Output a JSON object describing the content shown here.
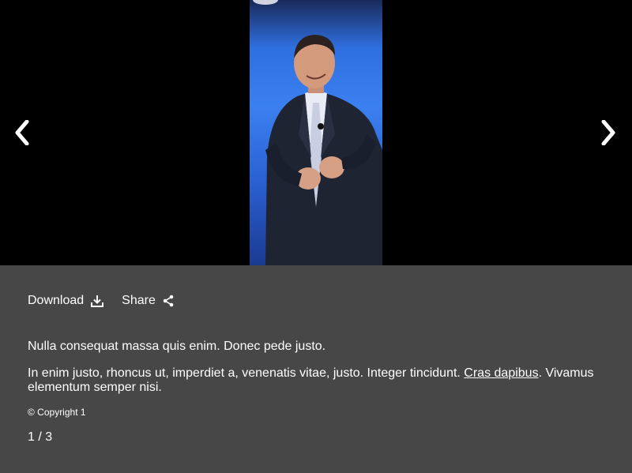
{
  "gallery": {
    "prev_icon": "chevron-left-icon",
    "next_icon": "chevron-right-icon"
  },
  "actions": {
    "download_label": "Download",
    "download_icon": "download-icon",
    "share_label": "Share",
    "share_icon": "share-icon"
  },
  "description": {
    "line1": "Nulla consequat massa quis enim. Donec pede justo.",
    "line2_before": "In enim justo, rhoncus ut, imperdiet a, venenatis vitae, justo. Integer tincidunt. ",
    "line2_link": "Cras dapibus",
    "line2_after": ". Vivamus elementum semper nisi."
  },
  "copyright": "© Copyright 1",
  "counter": {
    "current": "1",
    "separator": "/",
    "total": "3"
  },
  "colors": {
    "stage_bg": "#000000",
    "panel_bg": "#474747",
    "text": "#ffffff"
  }
}
